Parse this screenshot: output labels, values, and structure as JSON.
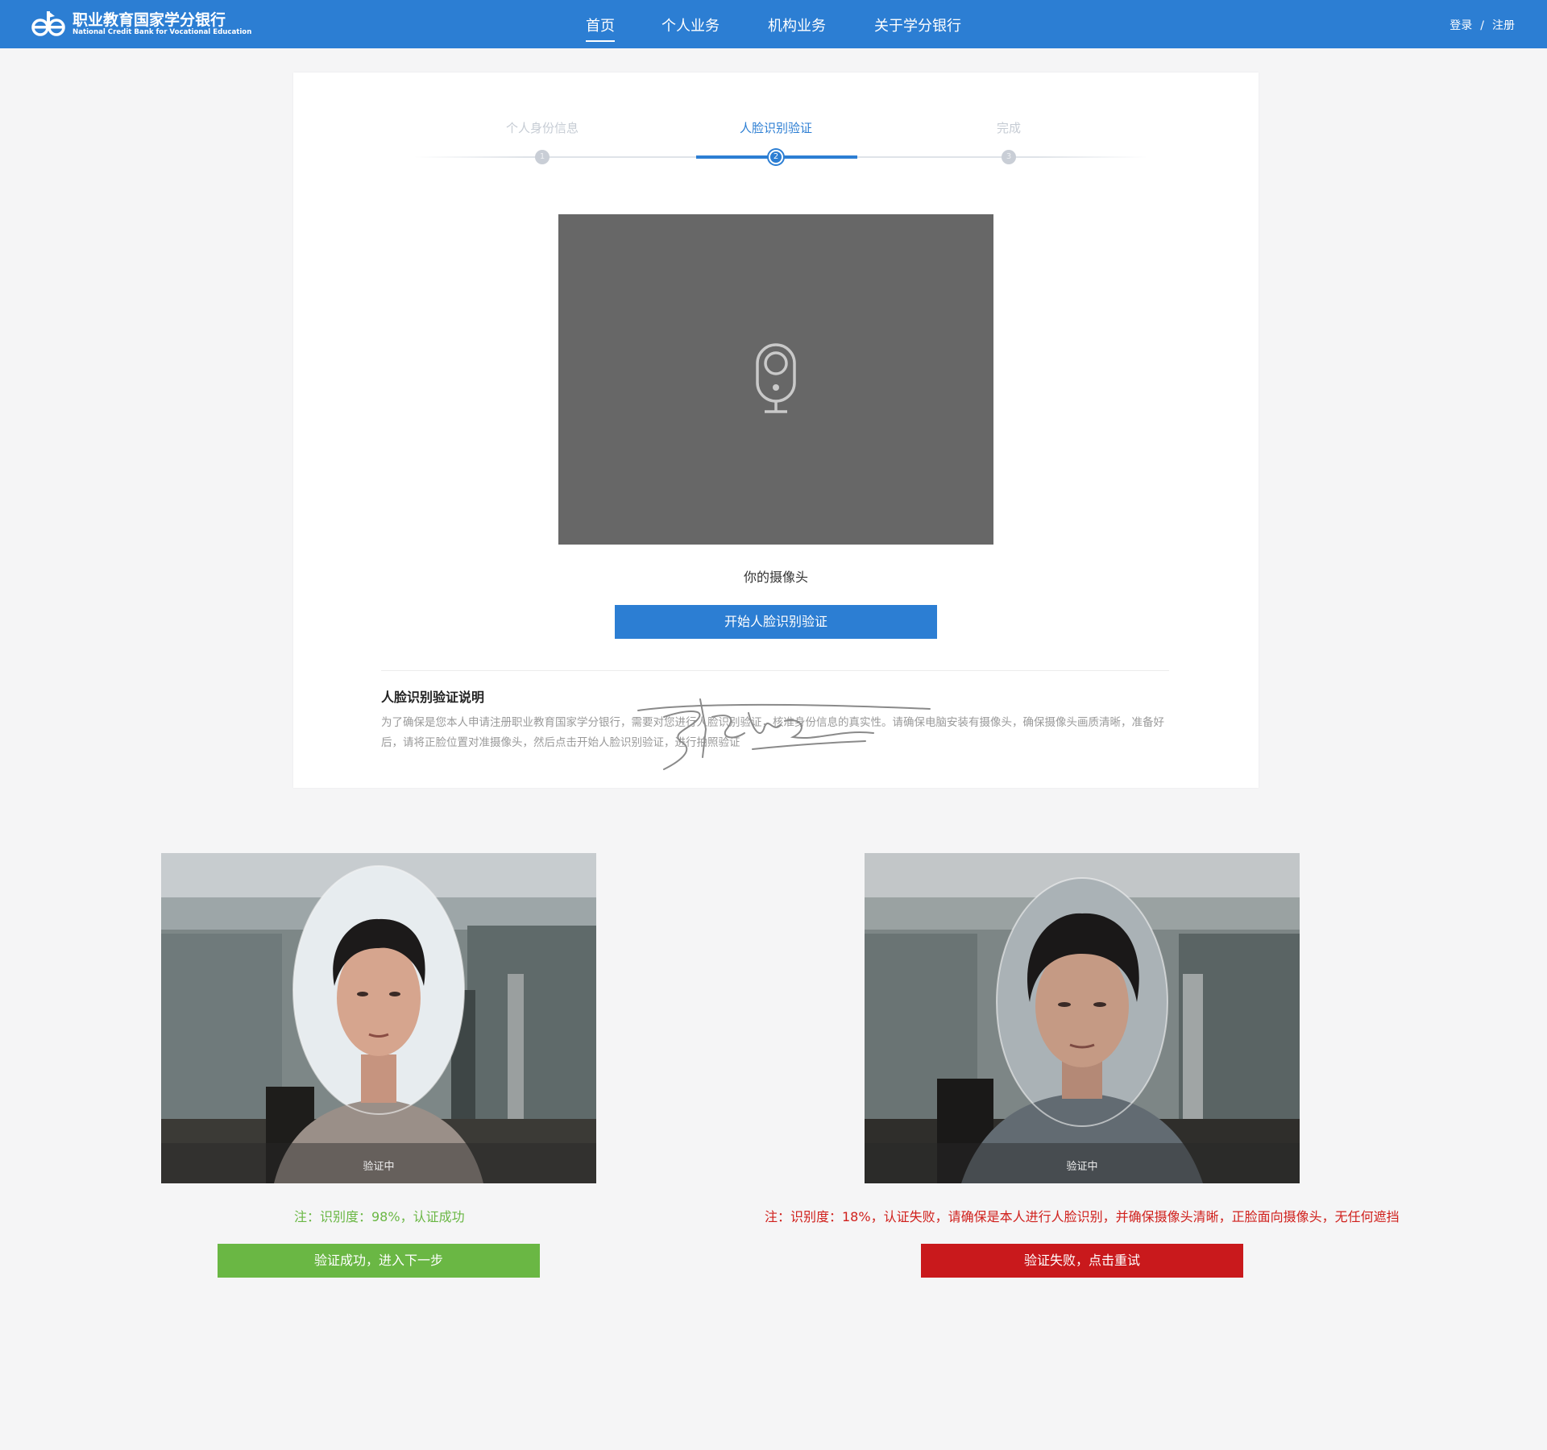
{
  "header": {
    "logo_name": "职业教育国家学分银行",
    "logo_subtitle": "National Credit Bank for Vocational Education",
    "nav": [
      {
        "label": "首页",
        "active": true
      },
      {
        "label": "个人业务",
        "active": false
      },
      {
        "label": "机构业务",
        "active": false
      },
      {
        "label": "关于学分银行",
        "active": false
      }
    ],
    "login_label": "登录",
    "separator": "/",
    "register_label": "注册",
    "brand_color": "#2c7ed3"
  },
  "steps": [
    {
      "label": "个人身份信息",
      "number": "1",
      "state": "done"
    },
    {
      "label": "人脸识别验证",
      "number": "2",
      "state": "active"
    },
    {
      "label": "完成",
      "number": "3",
      "state": "todo"
    }
  ],
  "camera": {
    "icon": "webcam-icon",
    "caption": "你的摄像头",
    "start_button": "开始人脸识别验证"
  },
  "instructions": {
    "title": "人脸识别验证说明",
    "text": "为了确保是您本人申请注册职业教育国家学分银行，需要对您进行人脸识别验证，核准身份信息的真实性。请确保电脑安装有摄像头，确保摄像头画质清晰，准备好后，请将正脸位置对准摄像头，然后点击开始人脸识别验证，进行拍照验证"
  },
  "demos": [
    {
      "status": "验证中",
      "result": "注：识别度：98%，认证成功",
      "button": "验证成功，进入下一步",
      "accent": "#6ab744",
      "similarity_percent": 98
    },
    {
      "status": "验证中",
      "result": "注：识别度：18%，认证失败，请确保是本人进行人脸识别，并确保摄像头清晰，正脸面向摄像头，无任何遮挡",
      "button": "验证失败，点击重试",
      "accent": "#d0201c",
      "similarity_percent": 18
    }
  ]
}
